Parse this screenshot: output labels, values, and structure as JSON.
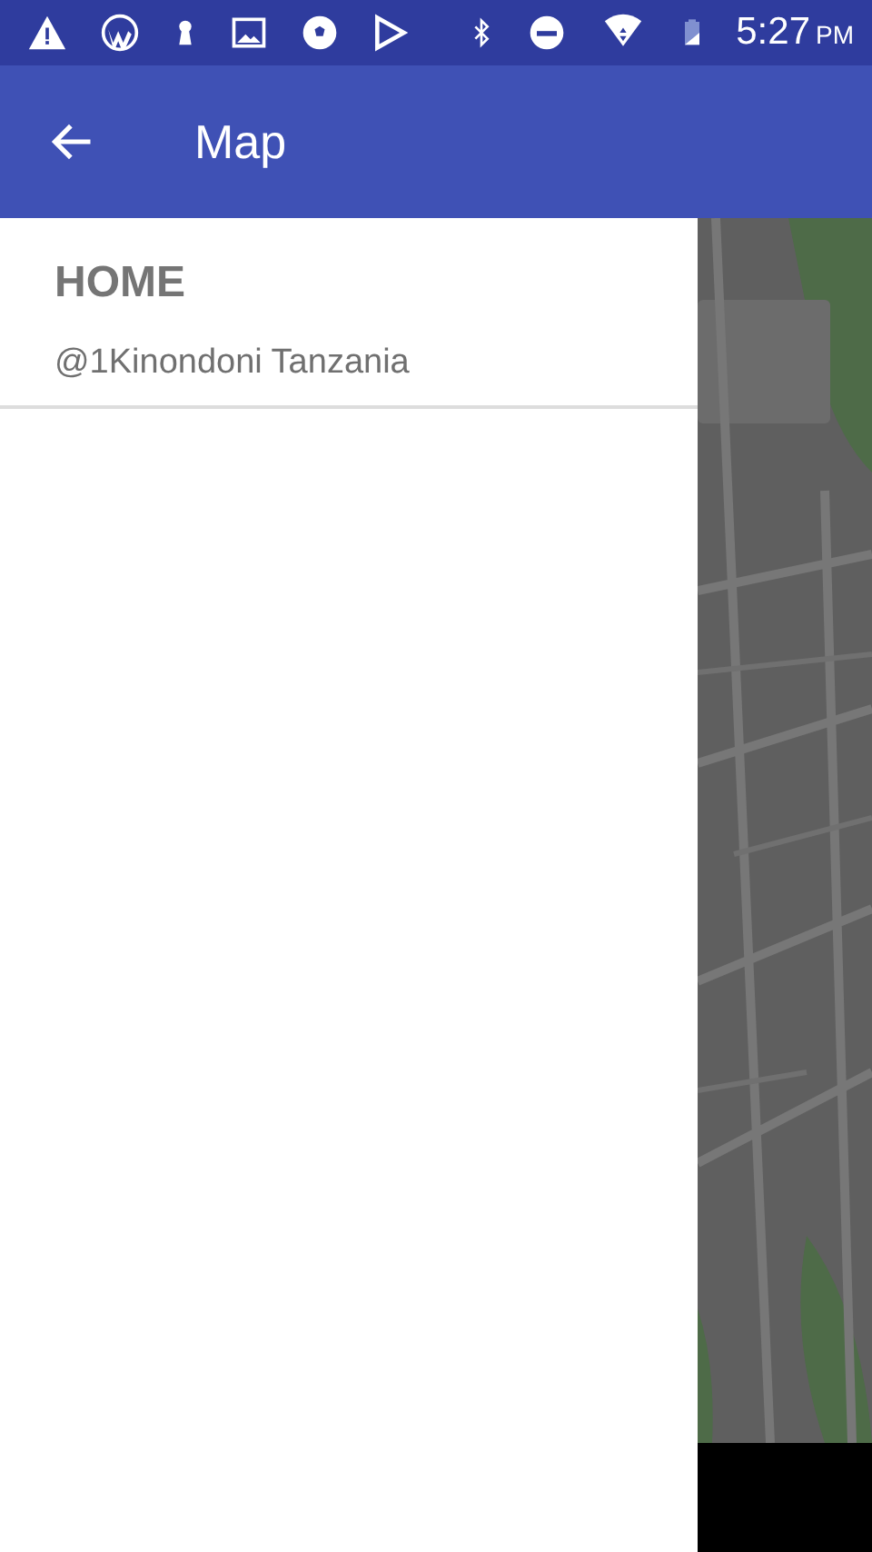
{
  "status_bar": {
    "time": "5:27",
    "period": "PM"
  },
  "app_bar": {
    "title": "Map"
  },
  "drawer": {
    "places": [
      {
        "heading": "HOME",
        "address": "@1Kinondoni Tanzania"
      }
    ]
  }
}
